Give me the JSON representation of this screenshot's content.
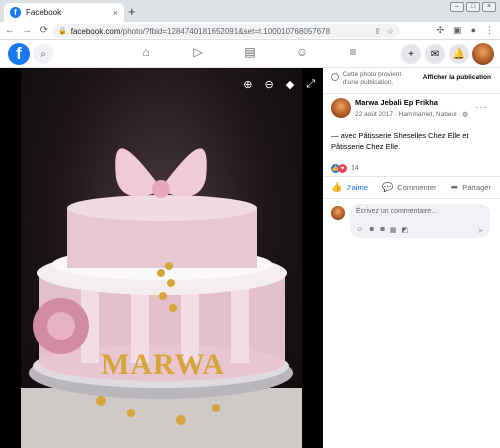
{
  "browser": {
    "tab_title": "Facebook",
    "tab_favicon": "f",
    "tab_close": "×",
    "new_tab": "+",
    "url_host": "facebook.com",
    "url_rest": "/photo/?fbid=1284740181652091&set=t.100010768057678"
  },
  "header": {
    "logo": "f"
  },
  "viewer": {
    "cake_name": "MARWA"
  },
  "side": {
    "notice_text": "Cette photo provient d’une publication.",
    "notice_button": "Afficher la publication",
    "author_name": "Marwa Jebali Ep Frikha",
    "post_meta": "22 août 2017 · Hammamet, Nabeul · ",
    "caption": "— avec Pâtisserie Sheselles Chez Elle et Pâtisserie Chez Elle.",
    "reaction_count": "14",
    "like_label": "J’aime",
    "comment_label": "Commenter",
    "share_label": "Partager",
    "comment_placeholder": "Écrivez un commentaire…"
  },
  "colors": {
    "brand": "#1877f2",
    "love": "#f33e58"
  }
}
